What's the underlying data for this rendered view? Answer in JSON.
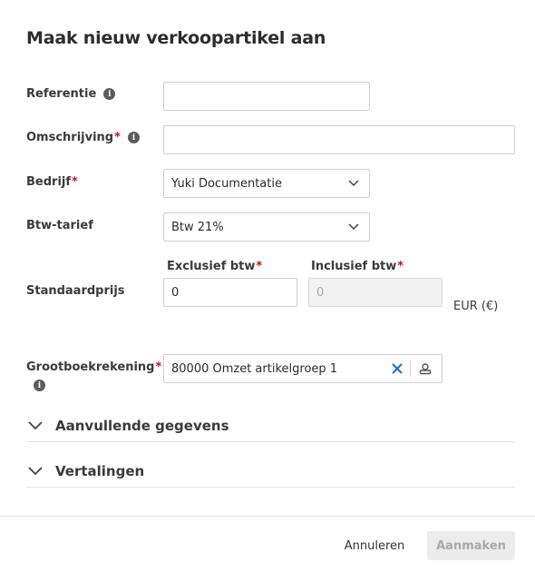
{
  "dialog": {
    "title": "Maak nieuw verkoopartikel aan"
  },
  "form": {
    "referentie": {
      "label": "Referentie",
      "value": ""
    },
    "omschrijving": {
      "label": "Omschrijving",
      "required": "*",
      "value": ""
    },
    "bedrijf": {
      "label": "Bedrijf",
      "required": "*",
      "value": "Yuki Documentatie"
    },
    "btw_tarief": {
      "label": "Btw-tarief",
      "value": "Btw 21%"
    },
    "standaardprijs": {
      "label": "Standaardprijs",
      "exclusief_label": "Exclusief btw",
      "exclusief_required": "*",
      "exclusief_value": "0",
      "inclusief_label": "Inclusief btw",
      "inclusief_required": "*",
      "inclusief_value": "0",
      "currency": "EUR (€)"
    },
    "grootboekrekening": {
      "label": "Grootboekrekening",
      "required": "*",
      "value": "80000 Omzet artikelgroep 1"
    }
  },
  "sections": {
    "aanvullende": "Aanvullende gegevens",
    "vertalingen": "Vertalingen"
  },
  "footer": {
    "cancel_label": "Annuleren",
    "create_label": "Aanmaken"
  },
  "colors": {
    "required": "#c0112b",
    "clear_icon": "#1e6fc2",
    "disabled_button_bg": "#ececec"
  },
  "icons": [
    "info-icon",
    "chevron-down-icon",
    "clear-x-icon",
    "lookup-icon"
  ]
}
